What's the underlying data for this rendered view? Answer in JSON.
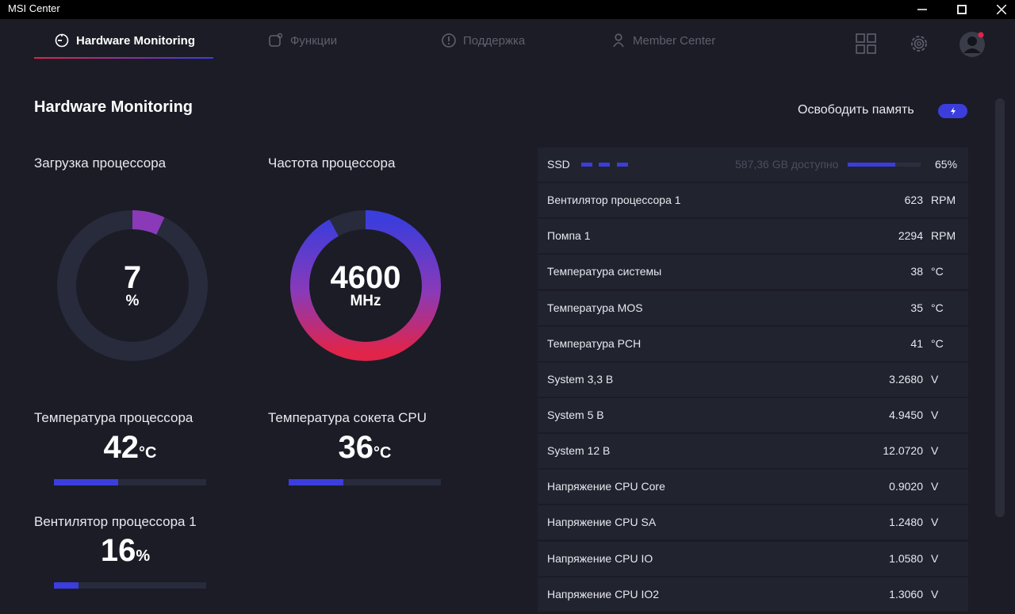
{
  "window": {
    "title": "MSI Center"
  },
  "nav": {
    "tabs": [
      {
        "label": "Hardware Monitoring",
        "icon": "gauge-icon",
        "active": true
      },
      {
        "label": "Функции",
        "icon": "features-icon",
        "active": false
      },
      {
        "label": "Поддержка",
        "icon": "support-icon",
        "active": false
      },
      {
        "label": "Member Center",
        "icon": "member-icon",
        "active": false
      }
    ],
    "icons": [
      "grid-icon",
      "gear-icon",
      "avatar-icon"
    ]
  },
  "page": {
    "title": "Hardware Monitoring",
    "free_memory_label": "Освободить память"
  },
  "cpu_load": {
    "label": "Загрузка процессора",
    "value": "7",
    "unit": "%",
    "fraction": 0.07
  },
  "cpu_freq": {
    "label": "Частота процессора",
    "value": "4600",
    "unit": "MHz",
    "fraction": 0.92
  },
  "cpu_temp": {
    "label": "Температура процессора",
    "value": "42",
    "unit": "°C",
    "fraction": 0.42
  },
  "socket_temp": {
    "label": "Температура сокета CPU",
    "value": "36",
    "unit": "°C",
    "fraction": 0.36
  },
  "cpu_fan": {
    "label": "Вентилятор процессора 1",
    "value": "16",
    "unit": "%",
    "fraction": 0.16
  },
  "ssd": {
    "name": "SSD",
    "available": "587,36 GB доступно",
    "percent": "65%",
    "fraction": 0.65
  },
  "sensors": [
    {
      "name": "Вентилятор процессора 1",
      "value": "623",
      "unit": "RPM"
    },
    {
      "name": "Помпа 1",
      "value": "2294",
      "unit": "RPM"
    },
    {
      "name": "Температура системы",
      "value": "38",
      "unit": "°C"
    },
    {
      "name": "Температура MOS",
      "value": "35",
      "unit": "°C"
    },
    {
      "name": "Темпеpатура PCH",
      "value": "41",
      "unit": "°C"
    },
    {
      "name": "System 3,3 В",
      "value": "3.2680",
      "unit": "V"
    },
    {
      "name": "System 5 В",
      "value": "4.9450",
      "unit": "V"
    },
    {
      "name": "System 12 В",
      "value": "12.0720",
      "unit": "V"
    },
    {
      "name": "Напряжение CPU Core",
      "value": "0.9020",
      "unit": "V"
    },
    {
      "name": "Напряжение CPU SA",
      "value": "1.2480",
      "unit": "V"
    },
    {
      "name": "Напряжение CPU IO",
      "value": "1.0580",
      "unit": "V"
    },
    {
      "name": "Напряжение CPU IO2",
      "value": "1.3060",
      "unit": "V"
    }
  ],
  "colors": {
    "accent": "#3b3ddc",
    "accent_red": "#e0244a",
    "background": "#1b1c26",
    "row": "#21232f"
  }
}
